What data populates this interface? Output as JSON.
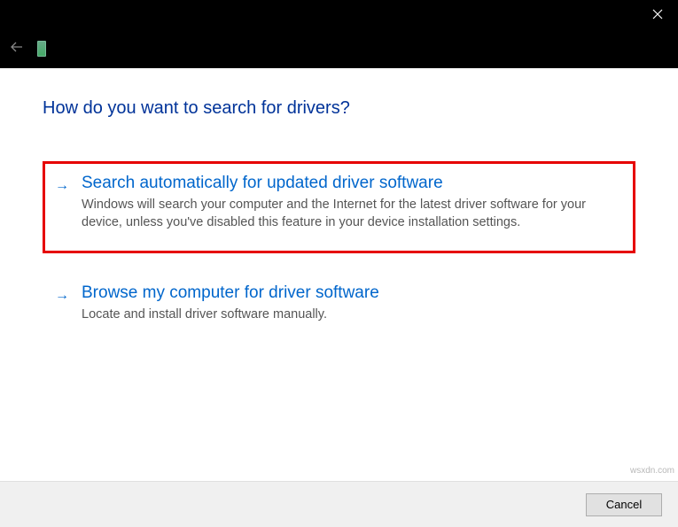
{
  "heading": "How do you want to search for drivers?",
  "options": [
    {
      "title": "Search automatically for updated driver software",
      "description": "Windows will search your computer and the Internet for the latest driver software for your device, unless you've disabled this feature in your device installation settings.",
      "highlighted": true
    },
    {
      "title": "Browse my computer for driver software",
      "description": "Locate and install driver software manually.",
      "highlighted": false
    }
  ],
  "buttons": {
    "cancel": "Cancel"
  },
  "watermark": "wsxdn.com"
}
